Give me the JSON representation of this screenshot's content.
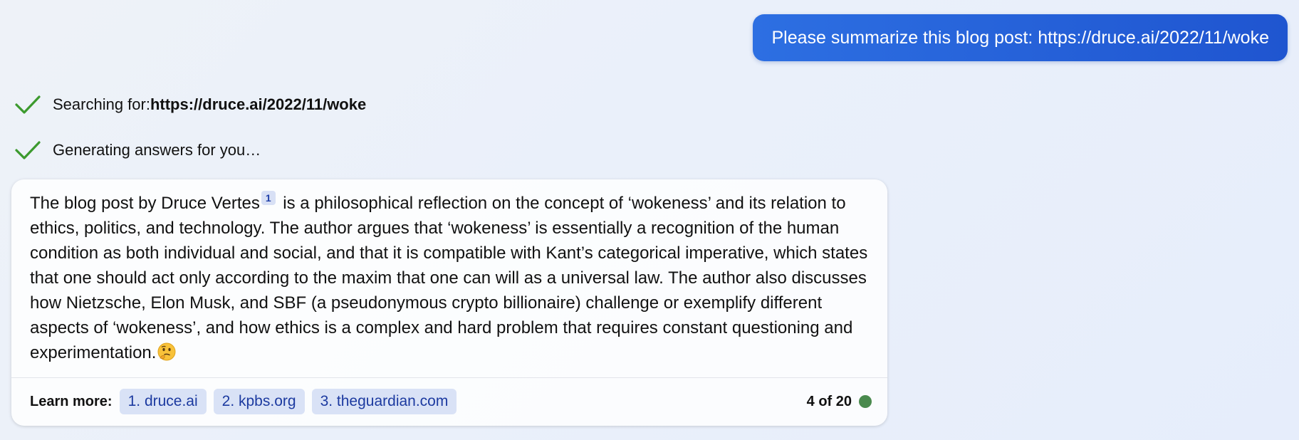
{
  "user_message": "Please summarize this blog post: https://druce.ai/2022/11/woke",
  "status": {
    "searching_prefix": "Searching for: ",
    "searching_query": "https://druce.ai/2022/11/woke",
    "generating": "Generating answers for you…"
  },
  "answer": {
    "before_cite": "The blog post by Druce Vertes",
    "cite_number": "1",
    "after_cite": " is a philosophical reflection on the concept of ‘wokeness’ and its relation to ethics, politics, and technology. The author argues that ‘wokeness’ is essentially a recognition of the human condition as both individual and social, and that it is compatible with Kant’s categorical imperative, which states that one should act only according to the maxim that one can will as a universal law. The author also discusses how Nietzsche, Elon Musk, and SBF (a pseudonymous crypto billionaire) challenge or exemplify different aspects of ‘wokeness’, and how ethics is a complex and hard problem that requires constant questioning and experimentation.",
    "emoji_icon": "thinking-face-icon"
  },
  "learn_more": {
    "label": "Learn more:",
    "links": [
      "1. druce.ai",
      "2. kpbs.org",
      "3. theguardian.com"
    ]
  },
  "counter": {
    "text": "4 of 20",
    "indicator_color": "#4a8a4e"
  },
  "colors": {
    "user_bubble": "#2462db",
    "check": "#3c9a2e",
    "link_bg": "#d9e2f6",
    "link_text": "#1c3aa0"
  }
}
